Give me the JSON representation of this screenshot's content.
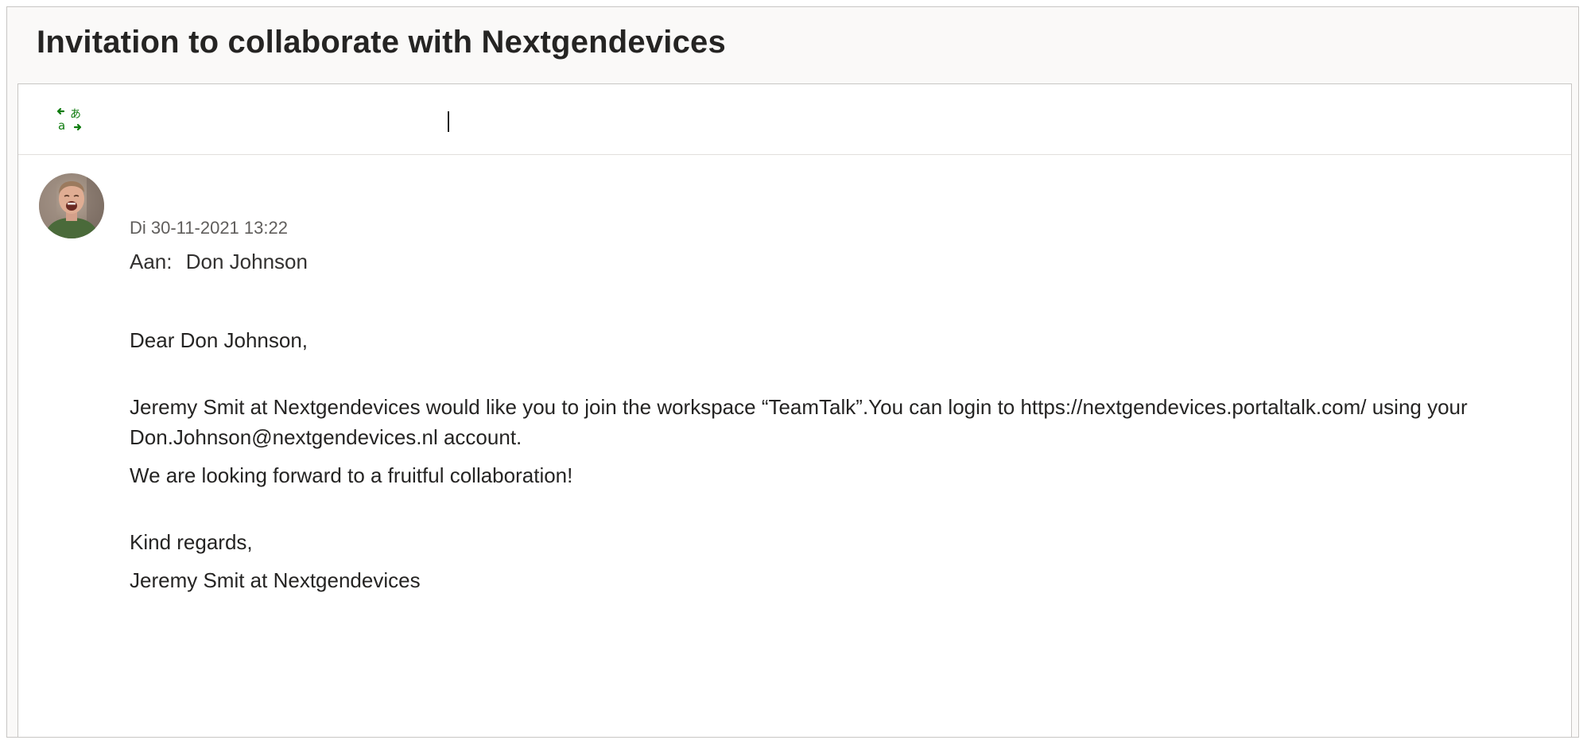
{
  "email": {
    "subject": "Invitation to collaborate with Nextgendevices",
    "date": "Di 30-11-2021 13:22",
    "to_label": "Aan:",
    "to_name": "Don Johnson",
    "greeting": "Dear Don Johnson,",
    "body_line1": "Jeremy Smit at Nextgendevices would like you to join the workspace “TeamTalk”.You can login to https://nextgendevices.portaltalk.com/ using your Don.Johnson@nextgendevices.nl account.",
    "body_line2": "We are looking forward to a fruitful collaboration!",
    "closing": "Kind regards,",
    "signature": "Jeremy Smit at Nextgendevices"
  },
  "toolbar": {
    "translate_icon": "translate-icon"
  },
  "colors": {
    "translate_icon": "#107c10",
    "subject_bar_bg": "#faf9f8",
    "border": "#c8c6c4"
  }
}
